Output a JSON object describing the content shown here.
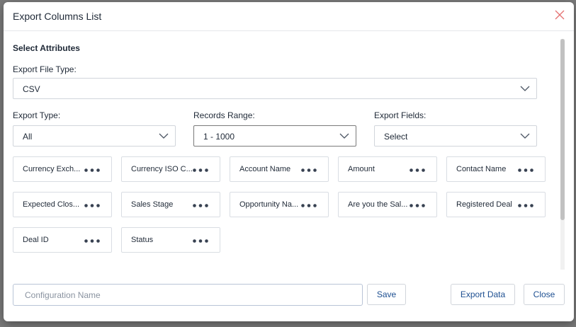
{
  "modal": {
    "title": "Export Columns List",
    "section_title": "Select Attributes"
  },
  "export_file_type": {
    "label": "Export File Type:",
    "value": "CSV"
  },
  "export_type": {
    "label": "Export Type:",
    "value": "All"
  },
  "records_range": {
    "label": "Records Range:",
    "value": "1 - 1000"
  },
  "export_fields": {
    "label": "Export Fields:",
    "value": "Select"
  },
  "attributes": [
    "Currency Exch...",
    "Currency ISO C...",
    "Account Name",
    "Amount",
    "Contact Name",
    "Expected Clos...",
    "Sales Stage",
    "Opportunity Na...",
    "Are you the Sal...",
    "Registered Deal",
    "Deal ID",
    "Status"
  ],
  "footer": {
    "config_placeholder": "Configuration Name",
    "save_label": "Save",
    "export_label": "Export Data",
    "close_label": "Close"
  },
  "colors": {
    "accent": "#1d4f91",
    "close_icon": "#e57373",
    "dots": "#374151"
  },
  "icons": {
    "close": "close-icon",
    "dropdown": "chevron-down-icon",
    "more": "more-horizontal-icon"
  }
}
